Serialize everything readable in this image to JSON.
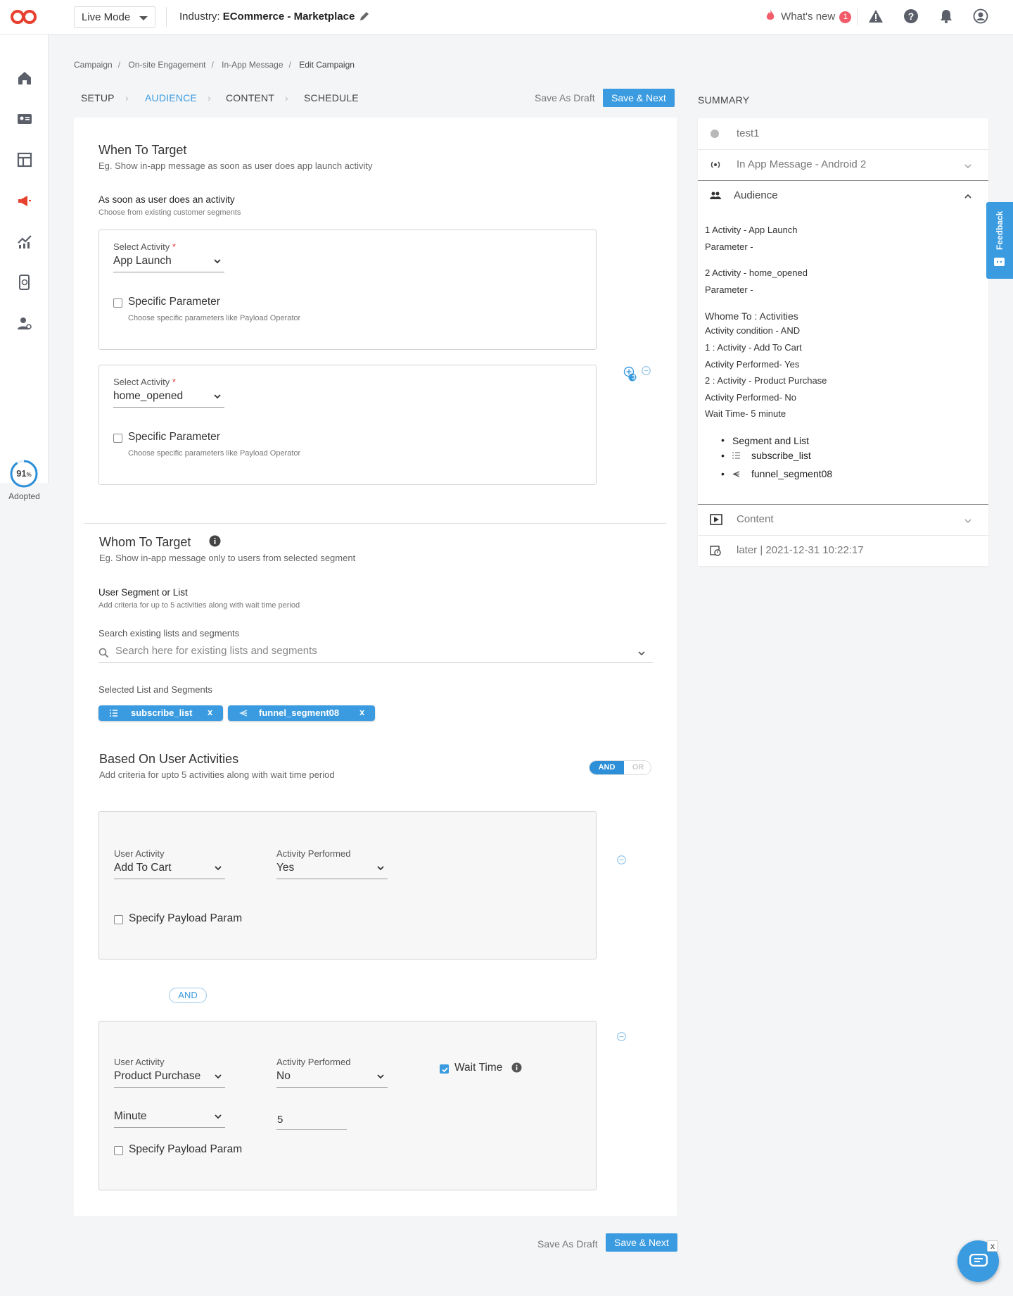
{
  "topbar": {
    "mode": "Live Mode",
    "industry_label": "Industry:",
    "industry_value": "ECommerce - Marketplace",
    "whats_new": "What's new",
    "whats_new_count": "1"
  },
  "leftnav": {
    "adopted_pct": "91",
    "adopted_unit": "%",
    "adopted_label": "Adopted",
    "adopted_fraction": 0.91
  },
  "breadcrumb": [
    "Campaign",
    "On-site Engagement",
    "In-App Message",
    "Edit Campaign"
  ],
  "tabs": [
    {
      "label": "SETUP",
      "active": false
    },
    {
      "label": "AUDIENCE",
      "active": true
    },
    {
      "label": "CONTENT",
      "active": false
    },
    {
      "label": "SCHEDULE",
      "active": false
    }
  ],
  "actions": {
    "save_draft": "Save As Draft",
    "save_next": "Save & Next"
  },
  "when": {
    "title": "When To Target",
    "subtitle": "Eg. Show in-app message as soon as user does app launch activity",
    "section_label": "As soon as user does an activity",
    "section_hint": "Choose from existing customer segments",
    "activities": [
      {
        "field_label": "Select Activity",
        "value": "App Launch",
        "param_label": "Specific Parameter",
        "param_hint": "Choose specific parameters like Payload Operator"
      },
      {
        "field_label": "Select Activity",
        "value": "home_opened",
        "param_label": "Specific Parameter",
        "param_hint": "Choose specific parameters like Payload Operator"
      }
    ],
    "add_count": "3"
  },
  "whom": {
    "title": "Whom To Target",
    "subtitle": "Eg. Show in-app message only to users from selected segment",
    "section_label": "User Segment or List",
    "section_hint": "Add criteria for up to 5 activities along with wait time period",
    "search_label": "Search existing lists and segments",
    "search_placeholder": "Search here for existing lists and segments",
    "selected_label": "Selected List and Segments",
    "chips": [
      {
        "label": "subscribe_list",
        "icon": "list-icon"
      },
      {
        "label": "funnel_segment08",
        "icon": "funnel-icon"
      }
    ]
  },
  "based": {
    "title": "Based On User Activities",
    "subtitle": "Add criteria for upto 5 activities along with wait time period",
    "toggle_on": "AND",
    "toggle_off": "OR",
    "and_pill": "AND",
    "rows": [
      {
        "activity_label": "User Activity",
        "activity": "Add To Cart",
        "performed_label": "Activity Performed",
        "performed": "Yes",
        "payload_label": "Specify Payload Param"
      },
      {
        "activity_label": "User Activity",
        "activity": "Product Purchase",
        "performed_label": "Activity Performed",
        "performed": "No",
        "wait_label": "Wait Time",
        "wait_unit": "Minute",
        "wait_value": "5",
        "payload_label": "Specify Payload Param"
      }
    ]
  },
  "summary": {
    "title": "SUMMARY",
    "name": "test1",
    "channel": "In App Message - Android 2",
    "audience": "Audience",
    "lines": [
      "1 Activity - App Launch",
      "Parameter -",
      "2 Activity - home_opened",
      "Parameter -",
      "Whome To : Activities",
      "Activity condition - AND",
      "1 : Activity - Add To Cart",
      "Activity Performed- Yes",
      "2 : Activity - Product Purchase",
      "Activity Performed- No",
      "Wait Time- 5 minute"
    ],
    "seg_heading": "Segment and List",
    "seg_items": [
      "subscribe_list",
      "funnel_segment08"
    ],
    "content": "Content",
    "schedule": "later | 2021-12-31 10:22:17"
  },
  "feedback": "Feedback",
  "colors": {
    "accent": "#3a9be0",
    "brand": "#e8402f",
    "badge": "#f25c6a"
  }
}
